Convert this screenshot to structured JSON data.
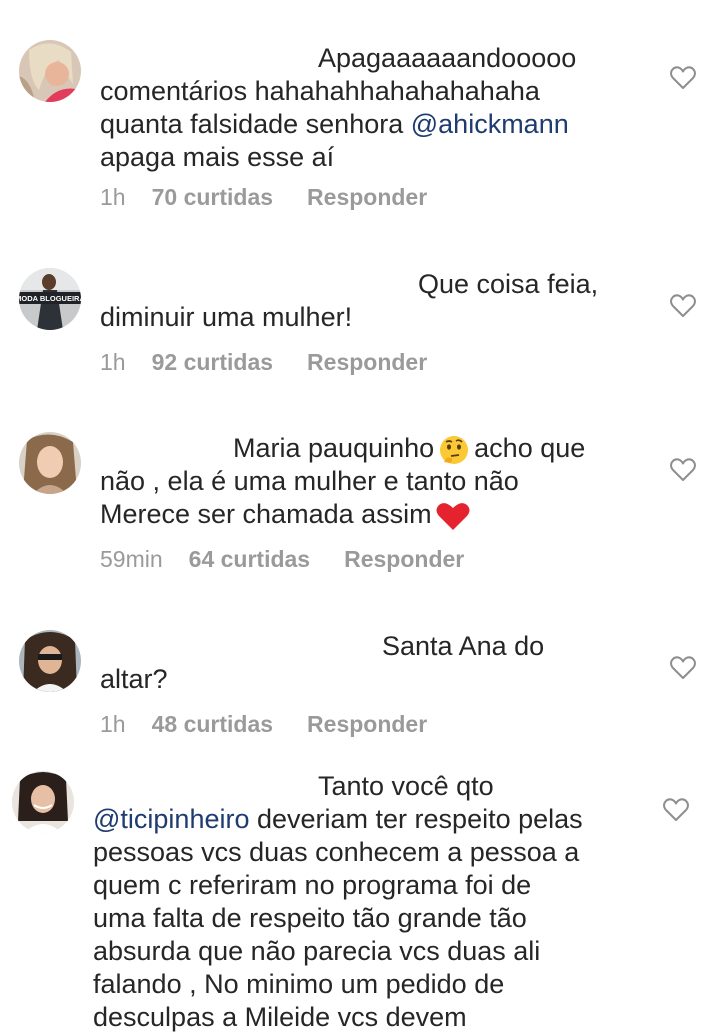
{
  "comments": [
    {
      "lines": [
        "Apagaaaaaandooooo",
        "comentários hahahahhahahahahaha",
        "quanta falsidade senhora ",
        "apaga mais esse aí"
      ],
      "mention": "@ahickmann",
      "time": "1h",
      "likes": "70 curtidas",
      "reply": "Responder"
    },
    {
      "avatar_text": "MODA BLOGUEIRA",
      "lines": [
        "Que coisa feia,",
        "diminuir uma mulher!"
      ],
      "time": "1h",
      "likes": "92 curtidas",
      "reply": "Responder"
    },
    {
      "lines": [
        "Maria pauquinho",
        "acho que",
        "não , ela é uma mulher e tanto não",
        "Merece ser chamada assim"
      ],
      "time": "59min",
      "likes": "64 curtidas",
      "reply": "Responder"
    },
    {
      "lines": [
        "Santa Ana do",
        "altar?"
      ],
      "time": "1h",
      "likes": "48 curtidas",
      "reply": "Responder"
    },
    {
      "lines": [
        "Tanto você qto",
        " deveriam ter respeito pelas",
        "pessoas vcs duas conhecem a pessoa a",
        "quem c referiram no programa foi de",
        "uma falta de respeito tão grande tão",
        "absurda que não parecia vcs duas ali",
        "falando , No minimo um pedido de",
        "desculpas a Mileide vcs devem"
      ],
      "mention": "@ticipinheiro"
    }
  ],
  "icons": {
    "heart": "heart-outline-icon",
    "thinking": "thinking-face-emoji",
    "red_heart": "red-heart-emoji"
  }
}
